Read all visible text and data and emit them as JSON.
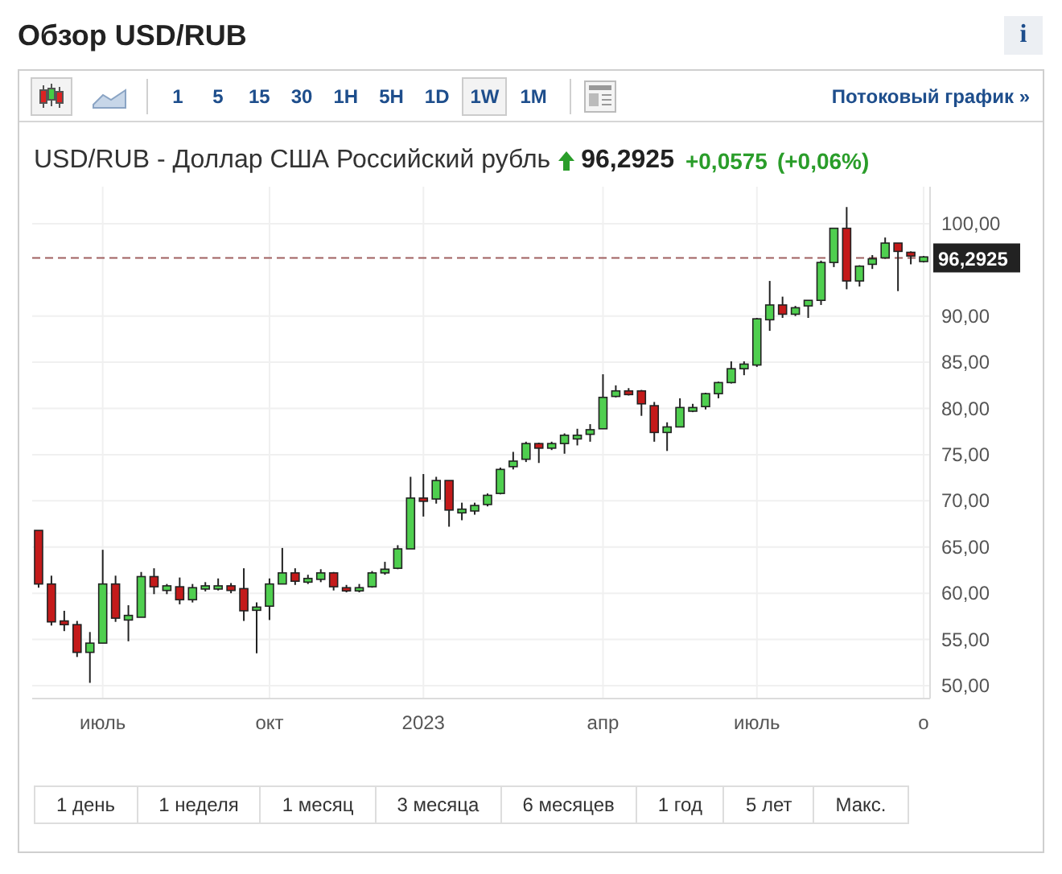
{
  "header": {
    "title": "Обзор USD/RUB",
    "info_button": "i"
  },
  "toolbar": {
    "chart_types": [
      {
        "kind": "candles",
        "selected": true
      },
      {
        "kind": "area",
        "selected": false
      }
    ],
    "intervals": [
      {
        "label": "1",
        "selected": false
      },
      {
        "label": "5",
        "selected": false
      },
      {
        "label": "15",
        "selected": false
      },
      {
        "label": "30",
        "selected": false
      },
      {
        "label": "1H",
        "selected": false
      },
      {
        "label": "5H",
        "selected": false
      },
      {
        "label": "1D",
        "selected": false
      },
      {
        "label": "1W",
        "selected": true
      },
      {
        "label": "1M",
        "selected": false
      }
    ],
    "streaming_link": "Потоковый график »"
  },
  "quote": {
    "name": "USD/RUB - Доллар США Российский рубль",
    "rising": true,
    "price": "96,2925",
    "change": "+0,0575",
    "change_percent": "(+0,06%)"
  },
  "chart": {
    "price_label": "96,2925",
    "chart_data": {
      "type": "candlestick",
      "ylim": [
        48.6,
        104
      ],
      "grid": true,
      "ref_lines": [
        {
          "axis": "y",
          "value": 96.2925
        }
      ],
      "categories": [
        null,
        null,
        null,
        null,
        null,
        "июль",
        null,
        null,
        null,
        null,
        null,
        null,
        null,
        null,
        null,
        null,
        null,
        null,
        "окт",
        null,
        null,
        null,
        null,
        null,
        null,
        null,
        null,
        null,
        null,
        null,
        "2023",
        null,
        null,
        null,
        null,
        null,
        null,
        null,
        null,
        null,
        null,
        null,
        null,
        null,
        "апр",
        null,
        null,
        null,
        null,
        null,
        null,
        null,
        null,
        null,
        null,
        null,
        "июль",
        null,
        null,
        null,
        null,
        null,
        null,
        null,
        null,
        null,
        null,
        null,
        null,
        "о"
      ],
      "yticks": [
        {
          "value": 100,
          "label": "100,00"
        },
        {
          "value": 90,
          "label": "90,00"
        },
        {
          "value": 85,
          "label": "85,00"
        },
        {
          "value": 80,
          "label": "80,00"
        },
        {
          "value": 75,
          "label": "75,00"
        },
        {
          "value": 70,
          "label": "70,00"
        },
        {
          "value": 65,
          "label": "65,00"
        },
        {
          "value": 60,
          "label": "60,00"
        },
        {
          "value": 55,
          "label": "55,00"
        },
        {
          "value": 50,
          "label": "50,00"
        }
      ],
      "ohlc": [
        [
          66.8,
          66.8,
          60.6,
          61.0
        ],
        [
          61.0,
          61.9,
          56.5,
          56.9
        ],
        [
          57.0,
          58.1,
          55.9,
          56.6
        ],
        [
          56.6,
          57.0,
          53.1,
          53.6
        ],
        [
          53.6,
          55.8,
          50.3,
          54.6
        ],
        [
          54.6,
          64.7,
          54.6,
          61.0
        ],
        [
          61.0,
          61.9,
          56.9,
          57.3
        ],
        [
          57.1,
          58.7,
          54.8,
          57.6
        ],
        [
          57.4,
          62.3,
          57.4,
          61.8
        ],
        [
          61.8,
          62.7,
          59.9,
          60.7
        ],
        [
          60.3,
          61.0,
          59.9,
          60.8
        ],
        [
          60.7,
          61.7,
          58.8,
          59.3
        ],
        [
          59.3,
          61.0,
          59.0,
          60.6
        ],
        [
          60.5,
          61.2,
          60.2,
          60.8
        ],
        [
          60.5,
          61.6,
          60.3,
          60.8
        ],
        [
          60.8,
          61.1,
          60.0,
          60.3
        ],
        [
          60.5,
          62.7,
          57.0,
          58.1
        ],
        [
          58.2,
          59.0,
          53.5,
          58.5
        ],
        [
          58.6,
          61.6,
          57.1,
          61.0
        ],
        [
          61.0,
          64.9,
          61.0,
          62.2
        ],
        [
          62.2,
          62.7,
          60.9,
          61.3
        ],
        [
          61.2,
          62.0,
          61.0,
          61.6
        ],
        [
          61.5,
          62.6,
          61.2,
          62.2
        ],
        [
          62.2,
          62.3,
          60.3,
          60.7
        ],
        [
          60.6,
          60.9,
          60.1,
          60.3
        ],
        [
          60.3,
          61.0,
          60.1,
          60.6
        ],
        [
          60.7,
          62.4,
          60.6,
          62.2
        ],
        [
          62.2,
          63.4,
          62.0,
          62.6
        ],
        [
          62.7,
          65.2,
          62.6,
          64.8
        ],
        [
          64.8,
          72.6,
          64.8,
          70.3
        ],
        [
          70.3,
          72.9,
          68.3,
          70.0
        ],
        [
          70.2,
          72.6,
          69.7,
          72.2
        ],
        [
          72.2,
          72.2,
          67.2,
          69.0
        ],
        [
          68.7,
          69.8,
          67.9,
          69.1
        ],
        [
          68.9,
          69.8,
          68.5,
          69.5
        ],
        [
          69.6,
          70.8,
          69.4,
          70.6
        ],
        [
          70.8,
          73.6,
          70.7,
          73.4
        ],
        [
          73.7,
          75.3,
          73.4,
          74.3
        ],
        [
          74.5,
          76.4,
          74.2,
          76.2
        ],
        [
          76.2,
          76.3,
          74.1,
          75.7
        ],
        [
          75.7,
          76.4,
          75.5,
          76.2
        ],
        [
          76.2,
          77.3,
          75.1,
          77.1
        ],
        [
          76.7,
          77.8,
          76.0,
          77.1
        ],
        [
          77.2,
          78.3,
          76.4,
          77.7
        ],
        [
          77.8,
          83.7,
          77.8,
          81.2
        ],
        [
          81.3,
          82.5,
          81.2,
          81.9
        ],
        [
          81.9,
          82.2,
          81.4,
          81.5
        ],
        [
          81.9,
          82.0,
          79.2,
          80.5
        ],
        [
          80.3,
          80.7,
          76.4,
          77.4
        ],
        [
          77.4,
          78.5,
          75.4,
          78.0
        ],
        [
          78.0,
          81.1,
          78.0,
          80.1
        ],
        [
          79.7,
          80.5,
          79.6,
          80.1
        ],
        [
          80.2,
          81.7,
          79.9,
          81.6
        ],
        [
          81.6,
          82.9,
          81.1,
          82.8
        ],
        [
          82.8,
          85.1,
          82.7,
          84.3
        ],
        [
          84.3,
          85.1,
          83.6,
          84.8
        ],
        [
          84.7,
          89.8,
          84.5,
          89.7
        ],
        [
          89.6,
          93.8,
          88.4,
          91.2
        ],
        [
          91.2,
          92.1,
          89.8,
          90.2
        ],
        [
          90.2,
          91.1,
          90.0,
          90.9
        ],
        [
          91.1,
          91.7,
          89.8,
          91.7
        ],
        [
          91.7,
          96.0,
          91.2,
          95.8
        ],
        [
          95.8,
          99.5,
          95.3,
          99.5
        ],
        [
          99.5,
          101.8,
          92.9,
          93.8
        ],
        [
          93.8,
          95.5,
          93.2,
          95.4
        ],
        [
          95.6,
          96.6,
          95.1,
          96.2
        ],
        [
          96.3,
          98.5,
          96.2,
          97.9
        ],
        [
          97.9,
          97.9,
          92.7,
          97.0
        ],
        [
          96.9,
          97.0,
          95.6,
          96.5
        ],
        [
          95.9,
          96.5,
          95.8,
          96.4
        ]
      ]
    }
  },
  "ranges": [
    {
      "label": "1 день",
      "selected": false
    },
    {
      "label": "1 неделя",
      "selected": false
    },
    {
      "label": "1 месяц",
      "selected": false
    },
    {
      "label": "3 месяца",
      "selected": false
    },
    {
      "label": "6 месяцев",
      "selected": false
    },
    {
      "label": "1 год",
      "selected": false
    },
    {
      "label": "5 лет",
      "selected": false
    },
    {
      "label": "Макс.",
      "selected": false
    }
  ]
}
